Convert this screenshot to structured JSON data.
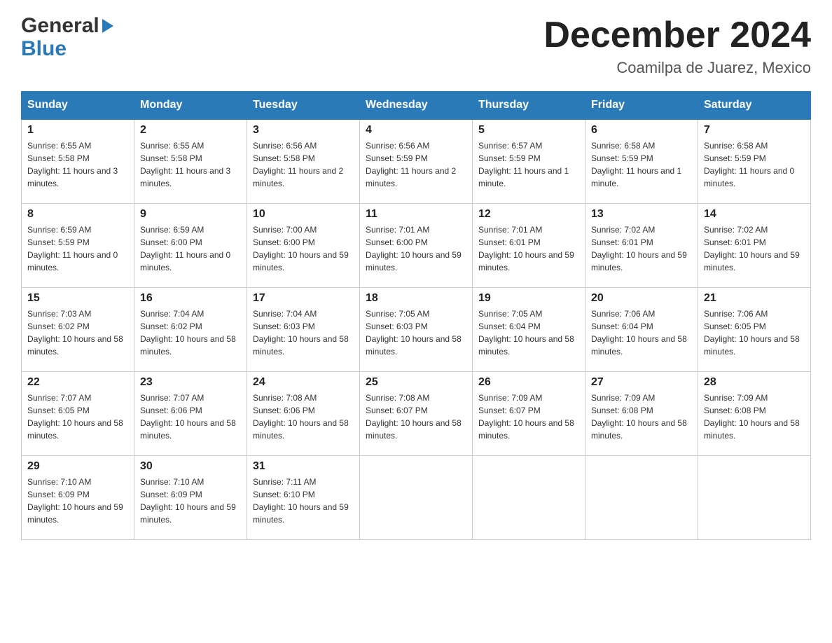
{
  "header": {
    "logo_general": "General",
    "logo_blue": "Blue",
    "month_title": "December 2024",
    "location": "Coamilpa de Juarez, Mexico"
  },
  "days_of_week": [
    "Sunday",
    "Monday",
    "Tuesday",
    "Wednesday",
    "Thursday",
    "Friday",
    "Saturday"
  ],
  "weeks": [
    [
      {
        "day": "1",
        "sunrise": "6:55 AM",
        "sunset": "5:58 PM",
        "daylight": "11 hours and 3 minutes."
      },
      {
        "day": "2",
        "sunrise": "6:55 AM",
        "sunset": "5:58 PM",
        "daylight": "11 hours and 3 minutes."
      },
      {
        "day": "3",
        "sunrise": "6:56 AM",
        "sunset": "5:58 PM",
        "daylight": "11 hours and 2 minutes."
      },
      {
        "day": "4",
        "sunrise": "6:56 AM",
        "sunset": "5:59 PM",
        "daylight": "11 hours and 2 minutes."
      },
      {
        "day": "5",
        "sunrise": "6:57 AM",
        "sunset": "5:59 PM",
        "daylight": "11 hours and 1 minute."
      },
      {
        "day": "6",
        "sunrise": "6:58 AM",
        "sunset": "5:59 PM",
        "daylight": "11 hours and 1 minute."
      },
      {
        "day": "7",
        "sunrise": "6:58 AM",
        "sunset": "5:59 PM",
        "daylight": "11 hours and 0 minutes."
      }
    ],
    [
      {
        "day": "8",
        "sunrise": "6:59 AM",
        "sunset": "5:59 PM",
        "daylight": "11 hours and 0 minutes."
      },
      {
        "day": "9",
        "sunrise": "6:59 AM",
        "sunset": "6:00 PM",
        "daylight": "11 hours and 0 minutes."
      },
      {
        "day": "10",
        "sunrise": "7:00 AM",
        "sunset": "6:00 PM",
        "daylight": "10 hours and 59 minutes."
      },
      {
        "day": "11",
        "sunrise": "7:01 AM",
        "sunset": "6:00 PM",
        "daylight": "10 hours and 59 minutes."
      },
      {
        "day": "12",
        "sunrise": "7:01 AM",
        "sunset": "6:01 PM",
        "daylight": "10 hours and 59 minutes."
      },
      {
        "day": "13",
        "sunrise": "7:02 AM",
        "sunset": "6:01 PM",
        "daylight": "10 hours and 59 minutes."
      },
      {
        "day": "14",
        "sunrise": "7:02 AM",
        "sunset": "6:01 PM",
        "daylight": "10 hours and 59 minutes."
      }
    ],
    [
      {
        "day": "15",
        "sunrise": "7:03 AM",
        "sunset": "6:02 PM",
        "daylight": "10 hours and 58 minutes."
      },
      {
        "day": "16",
        "sunrise": "7:04 AM",
        "sunset": "6:02 PM",
        "daylight": "10 hours and 58 minutes."
      },
      {
        "day": "17",
        "sunrise": "7:04 AM",
        "sunset": "6:03 PM",
        "daylight": "10 hours and 58 minutes."
      },
      {
        "day": "18",
        "sunrise": "7:05 AM",
        "sunset": "6:03 PM",
        "daylight": "10 hours and 58 minutes."
      },
      {
        "day": "19",
        "sunrise": "7:05 AM",
        "sunset": "6:04 PM",
        "daylight": "10 hours and 58 minutes."
      },
      {
        "day": "20",
        "sunrise": "7:06 AM",
        "sunset": "6:04 PM",
        "daylight": "10 hours and 58 minutes."
      },
      {
        "day": "21",
        "sunrise": "7:06 AM",
        "sunset": "6:05 PM",
        "daylight": "10 hours and 58 minutes."
      }
    ],
    [
      {
        "day": "22",
        "sunrise": "7:07 AM",
        "sunset": "6:05 PM",
        "daylight": "10 hours and 58 minutes."
      },
      {
        "day": "23",
        "sunrise": "7:07 AM",
        "sunset": "6:06 PM",
        "daylight": "10 hours and 58 minutes."
      },
      {
        "day": "24",
        "sunrise": "7:08 AM",
        "sunset": "6:06 PM",
        "daylight": "10 hours and 58 minutes."
      },
      {
        "day": "25",
        "sunrise": "7:08 AM",
        "sunset": "6:07 PM",
        "daylight": "10 hours and 58 minutes."
      },
      {
        "day": "26",
        "sunrise": "7:09 AM",
        "sunset": "6:07 PM",
        "daylight": "10 hours and 58 minutes."
      },
      {
        "day": "27",
        "sunrise": "7:09 AM",
        "sunset": "6:08 PM",
        "daylight": "10 hours and 58 minutes."
      },
      {
        "day": "28",
        "sunrise": "7:09 AM",
        "sunset": "6:08 PM",
        "daylight": "10 hours and 58 minutes."
      }
    ],
    [
      {
        "day": "29",
        "sunrise": "7:10 AM",
        "sunset": "6:09 PM",
        "daylight": "10 hours and 59 minutes."
      },
      {
        "day": "30",
        "sunrise": "7:10 AM",
        "sunset": "6:09 PM",
        "daylight": "10 hours and 59 minutes."
      },
      {
        "day": "31",
        "sunrise": "7:11 AM",
        "sunset": "6:10 PM",
        "daylight": "10 hours and 59 minutes."
      },
      null,
      null,
      null,
      null
    ]
  ],
  "labels": {
    "sunrise": "Sunrise:",
    "sunset": "Sunset:",
    "daylight": "Daylight:"
  }
}
